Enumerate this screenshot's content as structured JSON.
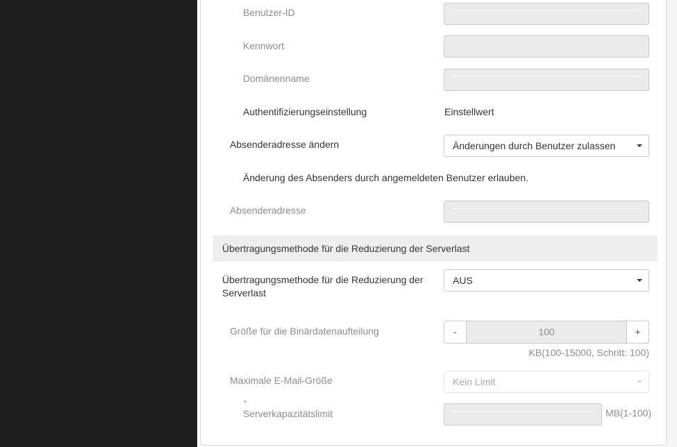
{
  "fields": {
    "user_id_label": "Benutzer-ID",
    "password_label": "Kennwort",
    "domain_label": "Domänenname",
    "auth_setting_label": "Authentifizierungseinstellung",
    "auth_setting_value": "Einstellwert",
    "change_sender_label": "Absenderadresse ändern",
    "change_sender_value": "Änderungen durch Benutzer zulassen",
    "change_sender_note": "Änderung des Absenders durch angemeldeten Benutzer erlauben.",
    "sender_address_label": "Absenderadresse"
  },
  "section": {
    "title": "Übertragungsmethode für die Reduzierung der Serverlast",
    "method_label_line1": "Übertragungsmethode für die Reduzierung der",
    "method_label_line2": "Serverlast",
    "method_value": "AUS",
    "split_size_label": "Größe für die Binärdatenaufteilung",
    "split_size_minus": "-",
    "split_size_value": "100",
    "split_size_plus": "+",
    "split_size_hint": "KB(100-15000, Schritt: 100)",
    "max_mail_label": "Maximale E-Mail-Größe",
    "max_mail_value": "Kein Limit",
    "server_limit_asterisk": "*",
    "server_limit_label": "Serverkapazitätslimit",
    "server_limit_unit": "MB(1-100)"
  }
}
